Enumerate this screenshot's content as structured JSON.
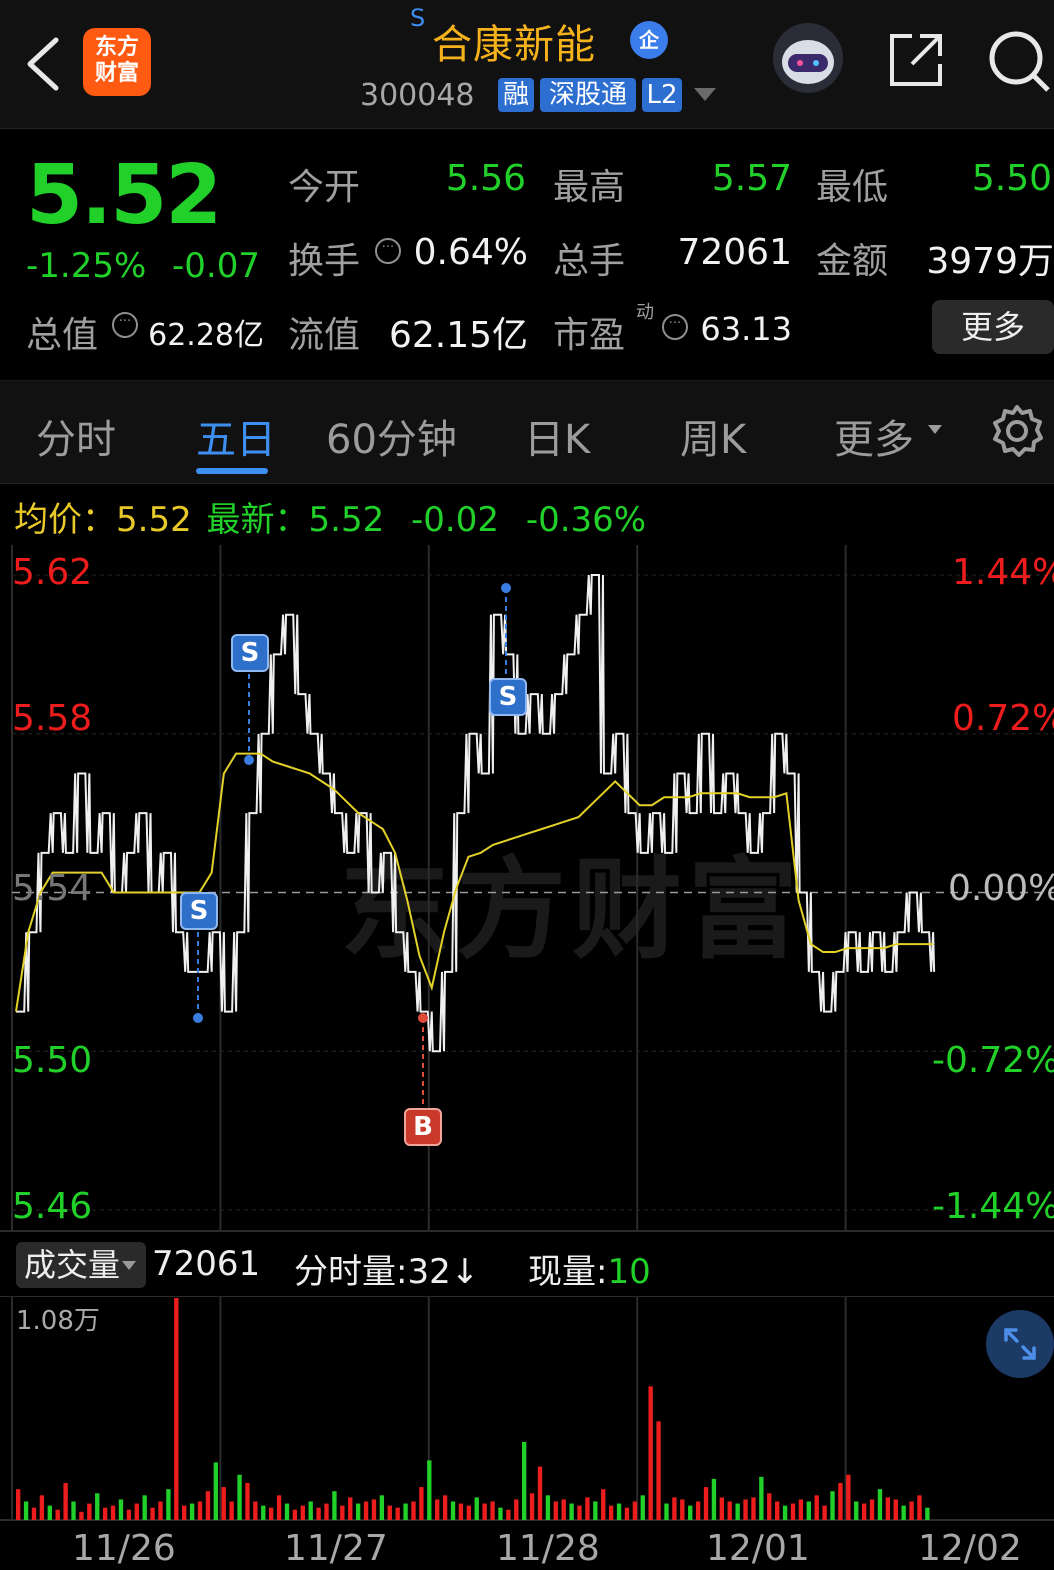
{
  "header": {
    "back_icon": "chevron-left-icon",
    "logo_line1": "东方",
    "logo_line2": "财富",
    "s_mark": "S",
    "stock_name": "合康新能",
    "qi_badge": "企",
    "stock_code": "300048",
    "tags": [
      "融",
      "深股通",
      "L2"
    ],
    "share_icon": "share-icon",
    "search_icon": "search-icon"
  },
  "quote": {
    "price": "5.52",
    "change_pct": "-1.25%",
    "change_abs": "-0.07",
    "open_label": "今开",
    "open_value": "5.56",
    "high_label": "最高",
    "high_value": "5.57",
    "low_label": "最低",
    "low_value": "5.50",
    "turnover_label": "换手",
    "turnover_value": "0.64%",
    "volume_label": "总手",
    "volume_value": "72061",
    "amount_label": "金额",
    "amount_value": "3979万",
    "mktcap_label": "总值",
    "mktcap_value": "62.28亿",
    "float_label": "流值",
    "float_value": "62.15亿",
    "pe_label": "市盈",
    "pe_sup": "动",
    "pe_value": "63.13",
    "more_label": "更多"
  },
  "tabs": [
    "分时",
    "五日",
    "60分钟",
    "日K",
    "周K",
    "更多"
  ],
  "active_tab": "五日",
  "avg_bar": {
    "avg_label": "均价：",
    "avg_value": "5.52",
    "latest_label": "最新：",
    "latest_value": "5.52",
    "change": "-0.02",
    "change_pct": "-0.36%"
  },
  "colors": {
    "up": "#ee1d1d",
    "down": "#22d02a",
    "price_line": "#f0f0f0",
    "avg_line": "#e3d12a",
    "accent": "#3e8ff2",
    "stock_name": "#f6b21b"
  },
  "chart_data": {
    "type": "line",
    "title": "",
    "y_left_ticks": [
      "5.62",
      "5.58",
      "5.54",
      "5.50",
      "5.46"
    ],
    "y_right_ticks": [
      "1.44%",
      "0.72%",
      "0.00%",
      "-0.72%",
      "-1.44%"
    ],
    "ylim": [
      5.46,
      5.62
    ],
    "x_days": [
      "11/26",
      "11/27",
      "11/28",
      "12/01",
      "12/02"
    ],
    "series": [
      {
        "name": "",
        "values": [
          5.51,
          5.53,
          5.55,
          5.56,
          5.55,
          5.57,
          5.55,
          5.56,
          5.54,
          5.55,
          5.56,
          5.54,
          5.55,
          5.53,
          5.52,
          5.52,
          5.53,
          5.51,
          5.53,
          5.56,
          5.58,
          5.6,
          5.61,
          5.59,
          5.58,
          5.57,
          5.56,
          5.55,
          5.56,
          5.54,
          5.55,
          5.53,
          5.52,
          5.51,
          5.5,
          5.52,
          5.56,
          5.58,
          5.57,
          5.61,
          5.6,
          5.58,
          5.59,
          5.58,
          5.59,
          5.6,
          5.61,
          5.62,
          5.57,
          5.58,
          5.56,
          5.55,
          5.56,
          5.55,
          5.57,
          5.56,
          5.58,
          5.56,
          5.57,
          5.56,
          5.55,
          5.56,
          5.58,
          5.57,
          5.54,
          5.52,
          5.51,
          5.52,
          5.53,
          5.52,
          5.53,
          5.52,
          5.53,
          5.54,
          5.53,
          5.52
        ]
      },
      {
        "name": "均价",
        "values": [
          5.51,
          5.53,
          5.54,
          5.545,
          5.545,
          5.545,
          5.545,
          5.545,
          5.54,
          5.54,
          5.54,
          5.54,
          5.54,
          5.54,
          5.54,
          5.54,
          5.545,
          5.57,
          5.575,
          5.575,
          5.575,
          5.573,
          5.572,
          5.571,
          5.57,
          5.568,
          5.566,
          5.563,
          5.56,
          5.558,
          5.556,
          5.55,
          5.538,
          5.524,
          5.516,
          5.53,
          5.541,
          5.549,
          5.55,
          5.552,
          5.553,
          5.554,
          5.555,
          5.556,
          5.557,
          5.558,
          5.559,
          5.562,
          5.565,
          5.568,
          5.565,
          5.562,
          5.562,
          5.564,
          5.564,
          5.564,
          5.565,
          5.565,
          5.565,
          5.565,
          5.564,
          5.564,
          5.564,
          5.565,
          5.538,
          5.527,
          5.525,
          5.525,
          5.526,
          5.526,
          5.526,
          5.526,
          5.527,
          5.527,
          5.527,
          5.527
        ]
      }
    ],
    "trade_markers": [
      {
        "label": "S",
        "day": "11/26",
        "price": 5.51
      },
      {
        "label": "S",
        "day": "11/26",
        "price": 5.58
      },
      {
        "label": "B",
        "day": "11/27",
        "price": 5.51
      },
      {
        "label": "S",
        "day": "11/28",
        "price": 5.61
      }
    ]
  },
  "volume": {
    "selector_label": "成交量",
    "total": "72061",
    "tick_label": "分时量:",
    "tick_value": "32",
    "tick_arrow": "↓",
    "now_label": "现量:",
    "now_value": "10",
    "max_label": "1.08万",
    "expand_icon": "expand-icon"
  },
  "volume_data": {
    "type": "bar",
    "max": 10800,
    "values": [
      1500,
      900,
      600,
      1200,
      700,
      500,
      1800,
      900,
      400,
      800,
      1300,
      600,
      700,
      1000,
      500,
      800,
      1200,
      600,
      900,
      1500,
      10800,
      700,
      800,
      900,
      1400,
      2800,
      1600,
      900,
      2200,
      1800,
      900,
      700,
      600,
      1200,
      800,
      500,
      700,
      900,
      600,
      800,
      1400,
      700,
      1100,
      800,
      900,
      1000,
      1200,
      700,
      600,
      800,
      900,
      1600,
      2900,
      1000,
      1200,
      900,
      800,
      700,
      1100,
      800,
      900,
      600,
      500,
      1000,
      3800,
      1300,
      2600,
      1200,
      900,
      1000,
      800,
      700,
      1100,
      900,
      1500,
      700,
      800,
      600,
      900,
      1200,
      6500,
      4800,
      800,
      1100,
      1000,
      700,
      900,
      1600,
      2000,
      1100,
      900,
      800,
      1000,
      1100,
      2100,
      1300,
      900,
      700,
      800,
      1000,
      900,
      1200,
      700,
      1400,
      1800,
      2200,
      900,
      800,
      1000,
      1500,
      1100,
      1000,
      700,
      900,
      1200,
      600
    ]
  }
}
